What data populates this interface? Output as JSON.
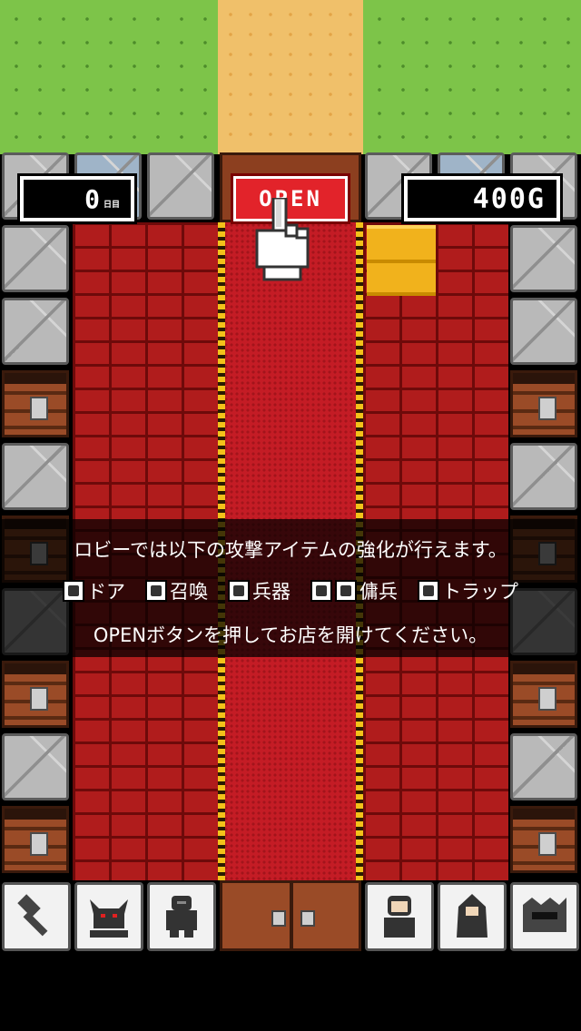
{
  "hud": {
    "day_value": "0",
    "day_unit": "日目",
    "gold": "400G",
    "open_label": "OPEN"
  },
  "info": {
    "line1": "ロビーでは以下の攻撃アイテムの強化が行えます。",
    "legend": [
      {
        "icon": "hammer-icon",
        "label": "ドア"
      },
      {
        "icon": "demon-icon",
        "label": "召喚"
      },
      {
        "icon": "armor-icon",
        "label": "兵器"
      },
      {
        "icon": "mercenary-icon",
        "label": "傭兵"
      },
      {
        "icon": "trap-icon",
        "label": "トラップ"
      }
    ],
    "line3": "OPENボタンを押してお店を開けてください。"
  },
  "toolbar": {
    "items": [
      {
        "icon": "hammer-icon",
        "label": "ドア"
      },
      {
        "icon": "demon-icon",
        "label": "召喚"
      },
      {
        "icon": "armor-icon",
        "label": "兵器"
      },
      {
        "icon": "door-icon",
        "label": ""
      },
      {
        "icon": "mercenary-icon",
        "label": "傭兵"
      },
      {
        "icon": "hooded-mercenary-icon",
        "label": "傭兵"
      },
      {
        "icon": "trap-icon",
        "label": "トラップ"
      }
    ]
  },
  "colors": {
    "grass": "#7dc449",
    "path": "#f0c06a",
    "brick": "#b01c1c",
    "carpet": "#c41c25",
    "open_button": "#e2232a",
    "rope": "#f3c21a"
  }
}
